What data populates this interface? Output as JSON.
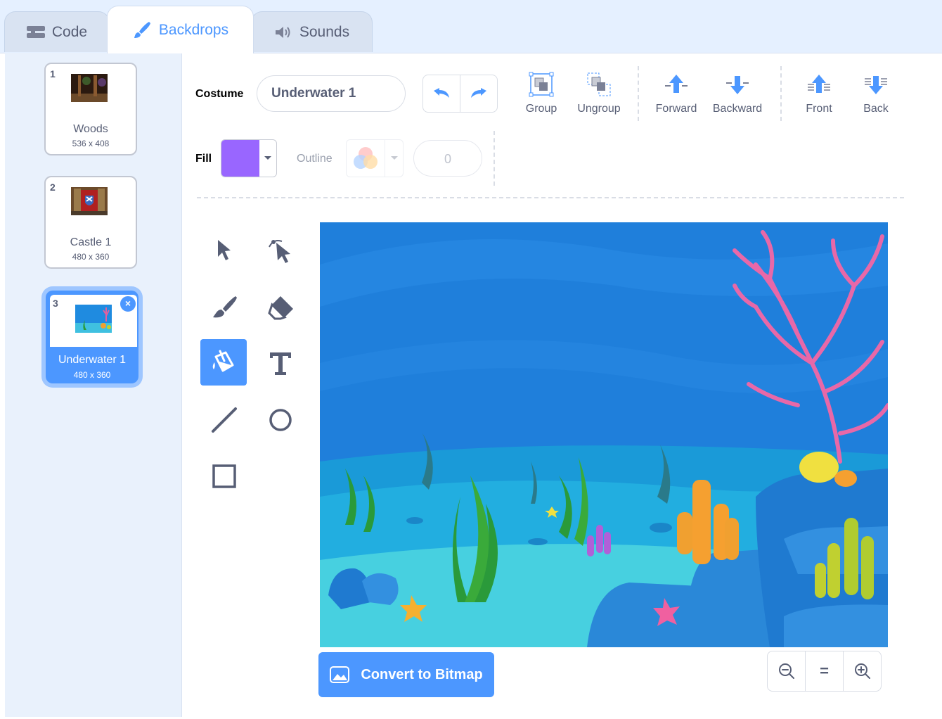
{
  "tabs": [
    {
      "label": "Code",
      "icon": "code-blocks-icon"
    },
    {
      "label": "Backdrops",
      "icon": "paintbrush-icon",
      "active": true
    },
    {
      "label": "Sounds",
      "icon": "speaker-icon"
    }
  ],
  "backdrops": [
    {
      "number": "1",
      "name": "Woods",
      "size": "536 x 408"
    },
    {
      "number": "2",
      "name": "Castle 1",
      "size": "480 x 360"
    },
    {
      "number": "3",
      "name": "Underwater 1",
      "size": "480 x 360",
      "selected": true
    }
  ],
  "toolbar": {
    "costume_label": "Costume",
    "costume_name": "Underwater 1",
    "group_label": "Group",
    "ungroup_label": "Ungroup",
    "forward_label": "Forward",
    "backward_label": "Backward",
    "front_label": "Front",
    "back_label": "Back",
    "fill_label": "Fill",
    "fill_color": "#9966ff",
    "outline_label": "Outline",
    "outline_width": "0"
  },
  "tools": [
    "select-icon",
    "reshape-icon",
    "brush-icon",
    "eraser-icon",
    "fill-icon",
    "text-icon",
    "line-icon",
    "circle-icon",
    "rectangle-icon"
  ],
  "active_tool": "fill-icon",
  "convert_label": "Convert to Bitmap",
  "zoom": {
    "equals_label": "="
  },
  "colors": {
    "accent": "#4c97ff",
    "fill": "#9966ff",
    "text": "#575e75"
  }
}
